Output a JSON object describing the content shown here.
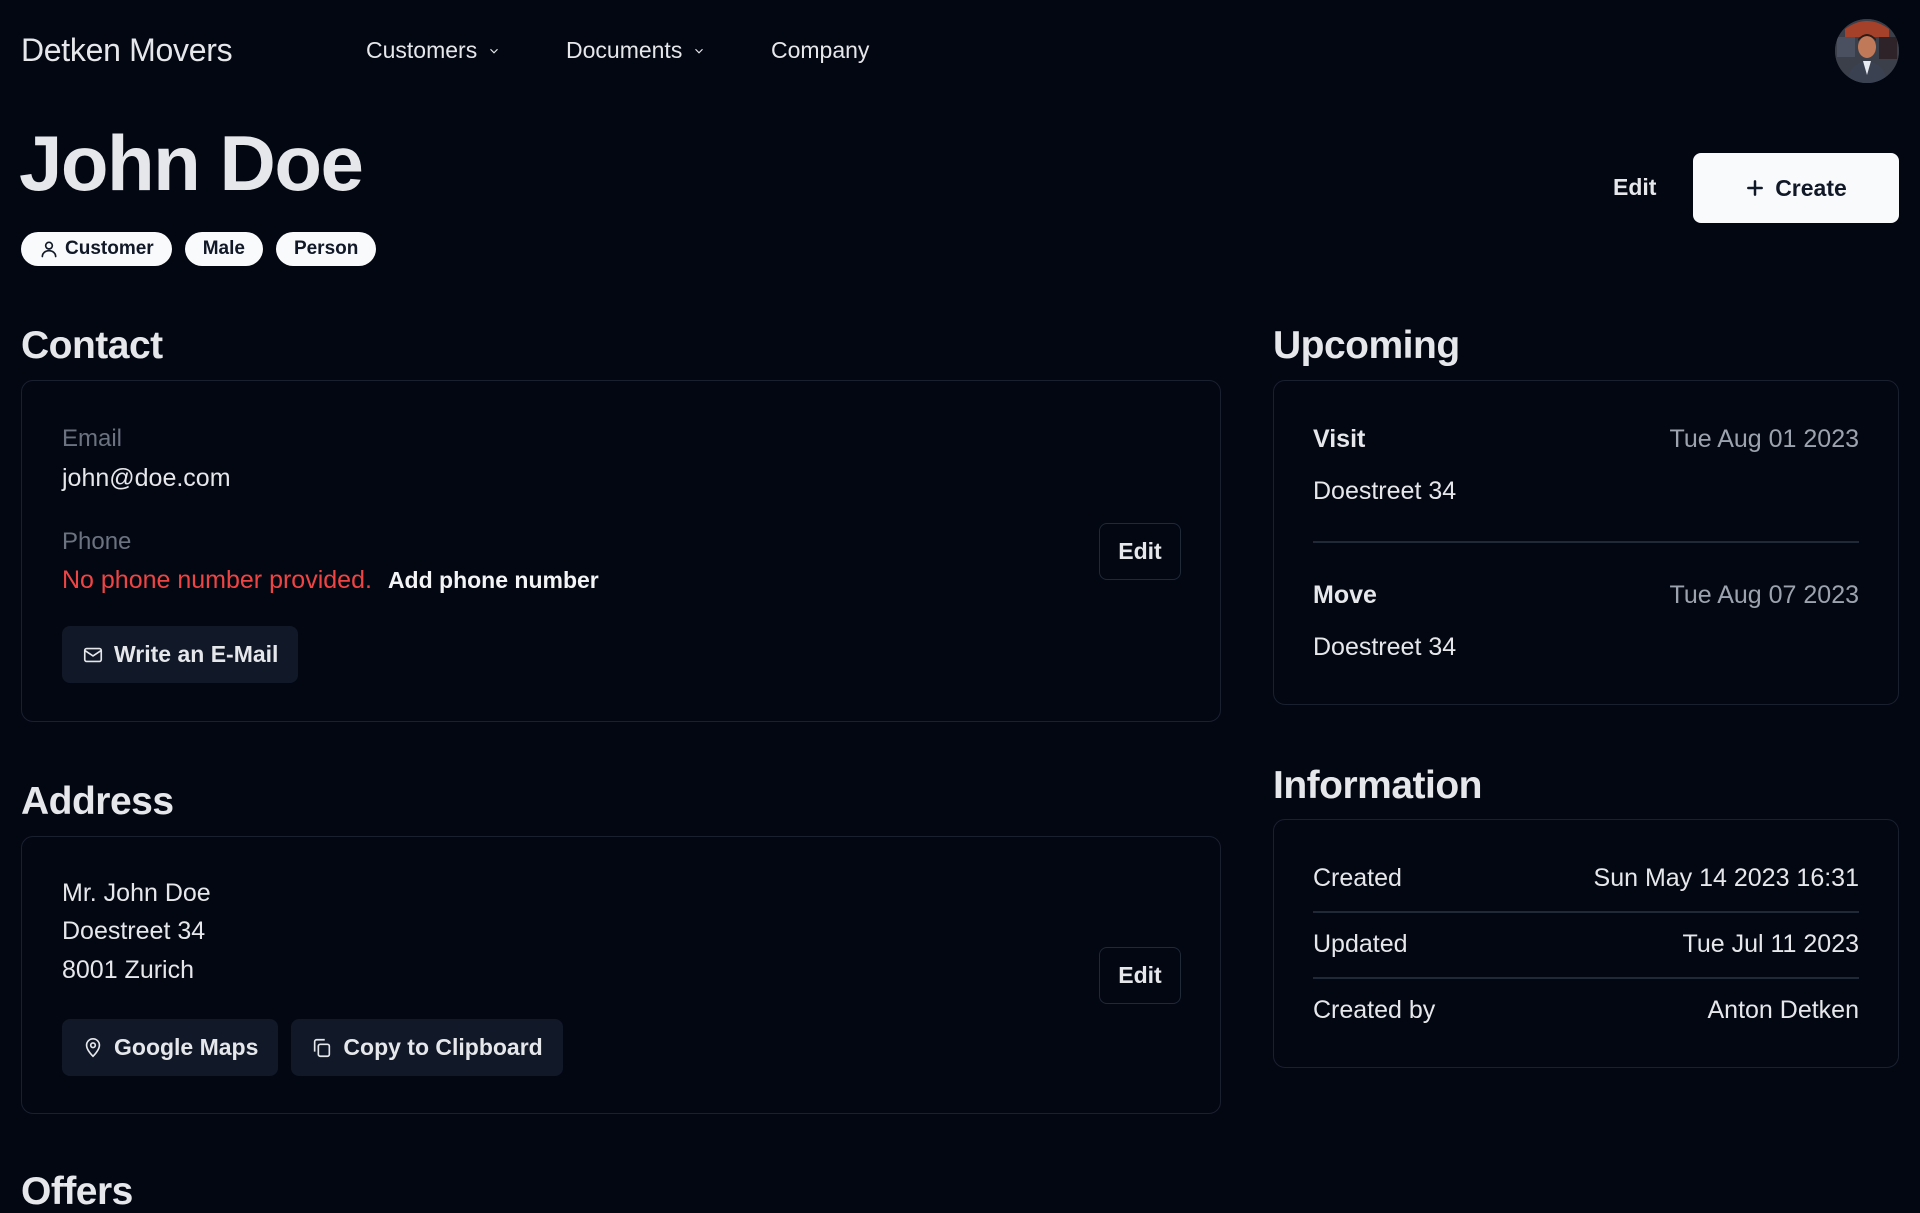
{
  "header": {
    "brand": "Detken Movers",
    "nav": [
      {
        "label": "Customers",
        "has_dropdown": true
      },
      {
        "label": "Documents",
        "has_dropdown": true
      },
      {
        "label": "Company",
        "has_dropdown": false
      }
    ],
    "avatar_alt": "User avatar"
  },
  "page": {
    "title": "John Doe",
    "badges": [
      {
        "label": "Customer",
        "icon": "user-icon"
      },
      {
        "label": "Male"
      },
      {
        "label": "Person"
      }
    ],
    "edit_label": "Edit",
    "create_label": "Create"
  },
  "contact": {
    "heading": "Contact",
    "email_label": "Email",
    "email_value": "john@doe.com",
    "phone_label": "Phone",
    "phone_missing": "No phone number provided.",
    "add_phone_label": "Add phone number",
    "write_email_label": "Write an E-Mail",
    "edit_label": "Edit"
  },
  "address": {
    "heading": "Address",
    "lines": [
      "Mr. John Doe",
      "Doestreet 34",
      "8001 Zurich"
    ],
    "google_maps_label": "Google Maps",
    "copy_label": "Copy to Clipboard",
    "edit_label": "Edit"
  },
  "upcoming": {
    "heading": "Upcoming",
    "items": [
      {
        "type": "Visit",
        "date": "Tue Aug 01 2023",
        "address": "Doestreet 34"
      },
      {
        "type": "Move",
        "date": "Tue Aug 07 2023",
        "address": "Doestreet 34"
      }
    ]
  },
  "information": {
    "heading": "Information",
    "rows": [
      {
        "label": "Created",
        "value": "Sun May 14 2023 16:31"
      },
      {
        "label": "Updated",
        "value": "Tue Jul 11 2023"
      },
      {
        "label": "Created by",
        "value": "Anton Detken"
      }
    ]
  },
  "offers": {
    "heading": "Offers"
  },
  "colors": {
    "background": "#030712",
    "text": "#e5e7eb",
    "muted": "#6b7280",
    "danger": "#ef4444",
    "button_dark": "#111827",
    "button_light": "#f9fafb"
  }
}
